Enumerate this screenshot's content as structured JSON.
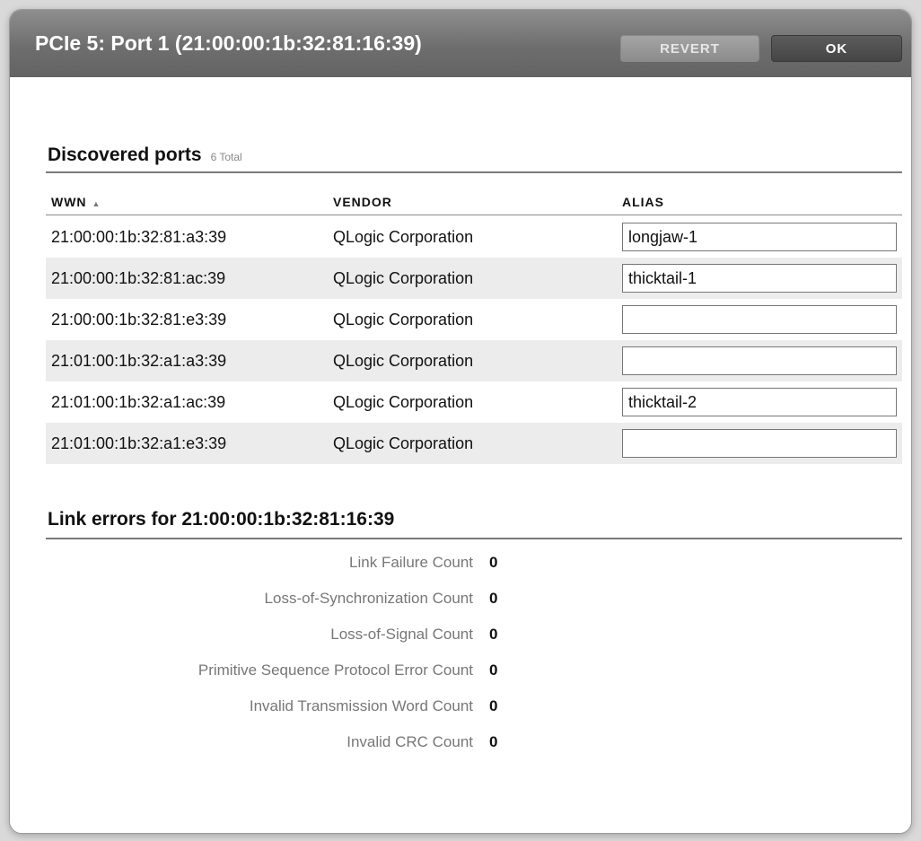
{
  "dialog": {
    "title": "PCIe 5: Port 1 (21:00:00:1b:32:81:16:39)",
    "revert_label": "REVERT",
    "ok_label": "OK"
  },
  "discovered": {
    "title": "Discovered ports",
    "count": "6 Total",
    "columns": {
      "wwn": "WWN",
      "vendor": "VENDOR",
      "alias": "ALIAS"
    },
    "sort_icon": "sort-ascending-icon",
    "rows": [
      {
        "wwn": "21:00:00:1b:32:81:a3:39",
        "vendor": "QLogic Corporation",
        "alias": "longjaw-1"
      },
      {
        "wwn": "21:00:00:1b:32:81:ac:39",
        "vendor": "QLogic Corporation",
        "alias": "thicktail-1"
      },
      {
        "wwn": "21:00:00:1b:32:81:e3:39",
        "vendor": "QLogic Corporation",
        "alias": ""
      },
      {
        "wwn": "21:01:00:1b:32:a1:a3:39",
        "vendor": "QLogic Corporation",
        "alias": ""
      },
      {
        "wwn": "21:01:00:1b:32:a1:ac:39",
        "vendor": "QLogic Corporation",
        "alias": "thicktail-2"
      },
      {
        "wwn": "21:01:00:1b:32:a1:e3:39",
        "vendor": "QLogic Corporation",
        "alias": ""
      }
    ]
  },
  "link_errors": {
    "title": "Link errors for 21:00:00:1b:32:81:16:39",
    "items": [
      {
        "label": "Link Failure Count",
        "value": "0"
      },
      {
        "label": "Loss-of-Synchronization Count",
        "value": "0"
      },
      {
        "label": "Loss-of-Signal Count",
        "value": "0"
      },
      {
        "label": "Primitive Sequence Protocol Error Count",
        "value": "0"
      },
      {
        "label": "Invalid Transmission Word Count",
        "value": "0"
      },
      {
        "label": "Invalid CRC Count",
        "value": "0"
      }
    ]
  },
  "colors": {
    "titlebar": "#6e6e6e",
    "row_alt": "#ececec",
    "ok_button": "#4f4f4f",
    "revert_button": "#999999"
  }
}
